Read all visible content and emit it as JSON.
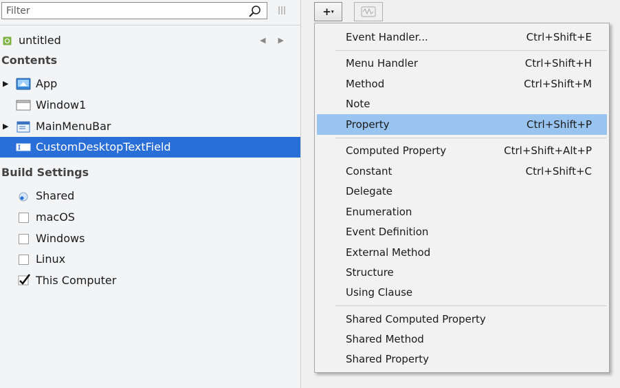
{
  "filter": {
    "placeholder": "Filter"
  },
  "navigator": {
    "project": "untitled",
    "contents_header": "Contents",
    "contents": [
      {
        "label": "App",
        "icon": "app-icon",
        "expandable": true
      },
      {
        "label": "Window1",
        "icon": "window-icon",
        "expandable": false
      },
      {
        "label": "MainMenuBar",
        "icon": "menubar-icon",
        "expandable": true
      },
      {
        "label": "CustomDesktopTextField",
        "icon": "textfield-icon",
        "expandable": false,
        "selected": true
      }
    ],
    "build_header": "Build Settings",
    "build": [
      {
        "label": "Shared",
        "icon": "shared-icon"
      },
      {
        "label": "macOS",
        "checked": false
      },
      {
        "label": "Windows",
        "checked": false
      },
      {
        "label": "Linux",
        "checked": false
      },
      {
        "label": "This Computer",
        "checked": true
      }
    ]
  },
  "toolbar": {
    "add_label": "+",
    "add_caret": "▾"
  },
  "menu": {
    "items": [
      {
        "label": "Event Handler...",
        "shortcut": "Ctrl+Shift+E"
      },
      {
        "label": "Menu Handler",
        "shortcut": "Ctrl+Shift+H"
      },
      {
        "label": "Method",
        "shortcut": "Ctrl+Shift+M"
      },
      {
        "label": "Note",
        "shortcut": ""
      },
      {
        "label": "Property",
        "shortcut": "Ctrl+Shift+P",
        "highlighted": true
      },
      {
        "label": "Computed Property",
        "shortcut": "Ctrl+Shift+Alt+P"
      },
      {
        "label": "Constant",
        "shortcut": "Ctrl+Shift+C"
      },
      {
        "label": "Delegate",
        "shortcut": ""
      },
      {
        "label": "Enumeration",
        "shortcut": ""
      },
      {
        "label": "Event Definition",
        "shortcut": ""
      },
      {
        "label": "External Method",
        "shortcut": ""
      },
      {
        "label": "Structure",
        "shortcut": ""
      },
      {
        "label": "Using Clause",
        "shortcut": ""
      },
      {
        "label": "Shared Computed Property",
        "shortcut": ""
      },
      {
        "label": "Shared Method",
        "shortcut": ""
      },
      {
        "label": "Shared Property",
        "shortcut": ""
      }
    ]
  },
  "colors": {
    "selection": "#2a6ed8",
    "menu_highlight": "#99c4ef"
  }
}
